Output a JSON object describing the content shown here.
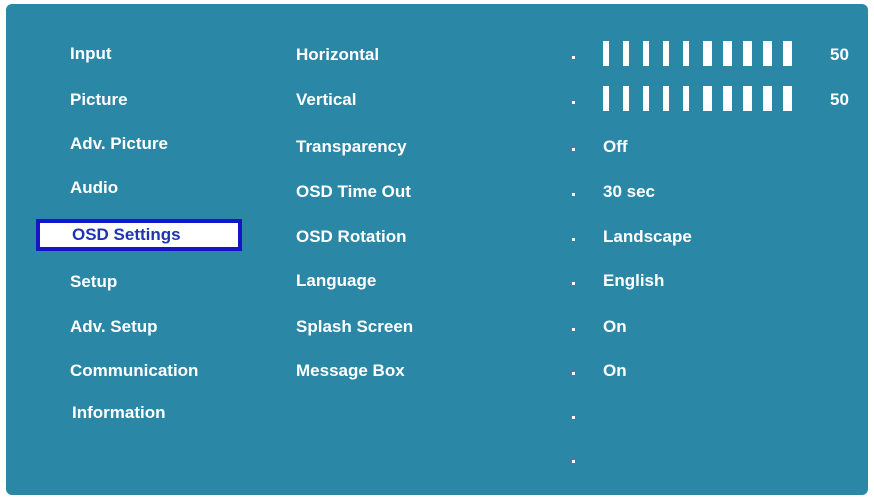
{
  "menu": {
    "items": [
      {
        "label": "Input"
      },
      {
        "label": "Picture"
      },
      {
        "label": "Adv. Picture"
      },
      {
        "label": "Audio"
      },
      {
        "label": "OSD Settings",
        "selected": true
      },
      {
        "label": "Setup"
      },
      {
        "label": "Adv. Setup"
      },
      {
        "label": "Communication"
      },
      {
        "label": "Information"
      }
    ]
  },
  "settings": {
    "horizontal": {
      "label": "Horizontal",
      "value": "50",
      "level": 0.5
    },
    "vertical": {
      "label": "Vertical",
      "value": "50",
      "level": 0.5
    },
    "transparency": {
      "label": "Transparency",
      "value": "Off"
    },
    "osd_time_out": {
      "label": "OSD Time Out",
      "value": "30 sec"
    },
    "osd_rotation": {
      "label": "OSD Rotation",
      "value": "Landscape"
    },
    "language": {
      "label": "Language",
      "value": "English"
    },
    "splash_screen": {
      "label": "Splash Screen",
      "value": "On"
    },
    "message_box": {
      "label": "Message Box",
      "value": "On"
    }
  },
  "colors": {
    "background": "#2b87a6",
    "text": "#ffffff",
    "selection_border": "#1414c8",
    "selection_text": "#1f34b3"
  }
}
